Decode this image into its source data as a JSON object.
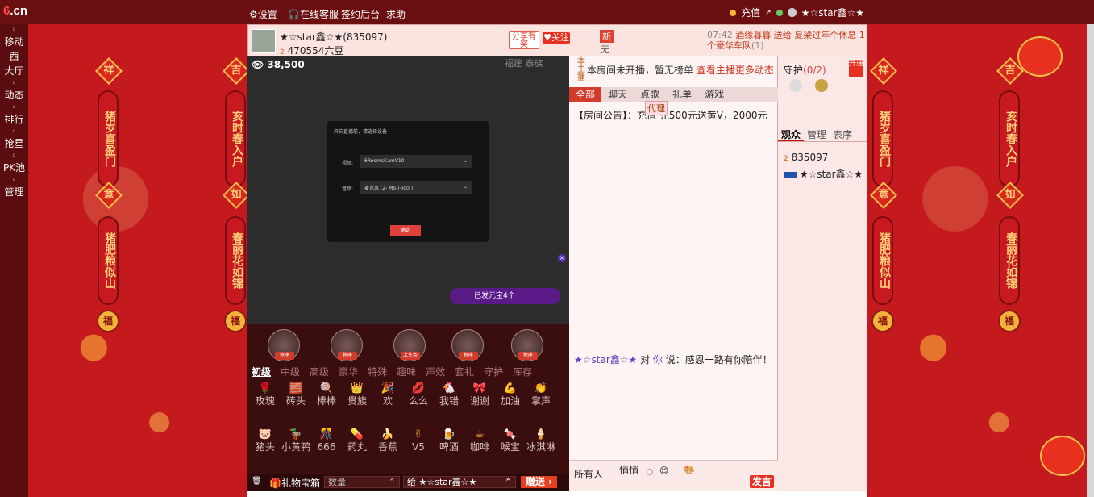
{
  "topbar": {
    "logo_num": "6",
    "logo_cn": ".cn",
    "settings": "设置",
    "customer_service": "在线客服",
    "checkin": "签约后台",
    "help": "求助",
    "recharge": "充值",
    "username": "★☆star鑫☆★"
  },
  "leftnav": [
    {
      "label": "移动",
      "icon": "phone-icon"
    },
    {
      "label": "西",
      "icon": ""
    },
    {
      "label": "大厅",
      "icon": ""
    },
    {
      "label": "动态",
      "icon": "compass-icon"
    },
    {
      "label": "排行",
      "icon": "crown-icon"
    },
    {
      "label": "抢星",
      "icon": "star-icon"
    },
    {
      "label": "PK池",
      "icon": "pk-icon"
    },
    {
      "label": "管理",
      "icon": "user-icon"
    }
  ],
  "couplets": {
    "left_top": "猪岁喜盈门",
    "left_bottom": "猪肥粮似山",
    "right_top": "亥时春入户",
    "right_bottom": "春丽花如锦",
    "char_ji": "祥",
    "char_ji2": "吉",
    "char_yi": "意",
    "char_ru": "如",
    "fu": "福"
  },
  "header": {
    "host_name": "★☆star鑫☆★(835097)",
    "host_beans": "470554六豆",
    "level_badge": "2",
    "share": "分享有奖",
    "follow": "关注",
    "new_tag": "新",
    "new_sub": "无",
    "ticker_time": "07:42",
    "ticker_text": "酒缘暮暮 送给 夏梁过年个休息 1个豪华车队",
    "ticker_tail": "(1)"
  },
  "video": {
    "viewer_count": "38,500",
    "live_label": "福建 泰族",
    "dialog_title": "开启直播前，请选择设备",
    "camera_label": "视频:",
    "camera_value": "6RoomsCamV10",
    "mic_label": "音频:",
    "mic_value": "麦克风 (2- MS-T600 )",
    "confirm": "确定",
    "promo": "已发元宝4个"
  },
  "pedestals": [
    {
      "label": "抢座"
    },
    {
      "label": "抢座"
    },
    {
      "label": "上头条"
    },
    {
      "label": "抢座"
    },
    {
      "label": "抢座"
    }
  ],
  "gift_tabs": [
    "初级",
    "中级",
    "高级",
    "豪华",
    "特殊",
    "趣味",
    "声效",
    "套礼",
    "守护",
    "库存"
  ],
  "gifts": [
    {
      "name": "玫瑰",
      "icon": "🌹"
    },
    {
      "name": "砖头",
      "icon": "🧱"
    },
    {
      "name": "棒棒",
      "icon": "🍭"
    },
    {
      "name": "贵族",
      "icon": "👑"
    },
    {
      "name": "欢",
      "icon": "🎉"
    },
    {
      "name": "么么",
      "icon": "💋"
    },
    {
      "name": "我错",
      "icon": "🐔"
    },
    {
      "name": "谢谢",
      "icon": "🎀"
    },
    {
      "name": "加油",
      "icon": "💪"
    },
    {
      "name": "掌声",
      "icon": "👏"
    },
    {
      "name": "猪头",
      "icon": "🐷"
    },
    {
      "name": "小黄鸭",
      "icon": "🦆"
    },
    {
      "name": "666",
      "icon": "🎊"
    },
    {
      "name": "药丸",
      "icon": "💊"
    },
    {
      "name": "香蕉",
      "icon": "🍌"
    },
    {
      "name": "V5",
      "icon": "✌"
    },
    {
      "name": "啤酒",
      "icon": "🍺"
    },
    {
      "name": "咖啡",
      "icon": "☕"
    },
    {
      "name": "喉宝",
      "icon": "🍬"
    },
    {
      "name": "冰淇淋",
      "icon": "🍦"
    }
  ],
  "bottom": {
    "treasure": "礼物宝箱",
    "quantity_placeholder": "数量",
    "to_user": "给 ★☆star鑫☆★",
    "send": "赠送"
  },
  "chat": {
    "notice_bar": "本房间未开播，暂无榜单",
    "notice_link": "查看主播更多动态",
    "side_tag": "本主播",
    "tabs": [
      "全部",
      "聊天",
      "点歌",
      "礼单",
      "游戏"
    ],
    "announcement": "【房间公告】：充值  充500元送黄V，2000元",
    "announce_tag": "代理",
    "message_user": "★☆star鑫☆★",
    "message_mid": " 对 ",
    "message_you": "你",
    "message_text": " 说：感恩一路有你陪伴！",
    "to_all": "所有人",
    "whisper": "悄悄",
    "post": "发言"
  },
  "guard": {
    "title": "守护",
    "count": "(0/2)",
    "open": "开通",
    "tabs": [
      "观众",
      "管理",
      "表序"
    ],
    "viewer_level": "2",
    "viewer_id": "835097",
    "viewer_name": "★☆star鑫☆★"
  },
  "colors": {
    "accent": "#d23a2a",
    "topbar": "#6a0e10",
    "background": "#c41a1e"
  }
}
